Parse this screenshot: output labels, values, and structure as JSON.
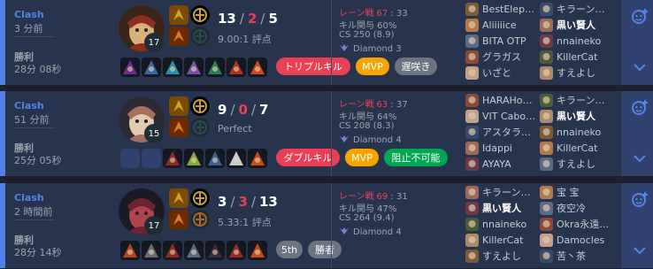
{
  "matches": [
    {
      "type": "Clash",
      "time": "3 分前",
      "result": "勝利",
      "duration": "28分 08秒",
      "level": "17",
      "kills": "13",
      "deaths": "2",
      "assists": "5",
      "ratio": "9.00:1 評点",
      "lane_label": "レーン戦",
      "lane_score": "67",
      "lane_opp": "33",
      "kp": "キル関与 60%",
      "cs": "CS 250 (8.9)",
      "rank": "Diamond 3",
      "badges": [
        "トリプルキル",
        "MVP",
        "遅咲き"
      ],
      "team_a": [
        "BestElep…",
        "Aliiiiice",
        "BITA OTP",
        "グラガス",
        "いざと"
      ],
      "team_b": [
        "キラーン…",
        "黒い賢人",
        "nnaineko",
        "KillerCat",
        "すえよし"
      ],
      "me_team": "b",
      "me_index": 1
    },
    {
      "type": "Clash",
      "time": "51 分前",
      "result": "勝利",
      "duration": "25分 05秒",
      "level": "15",
      "kills": "9",
      "deaths": "0",
      "assists": "7",
      "ratio": "Perfect",
      "lane_label": "レーン戦",
      "lane_score": "63",
      "lane_opp": "37",
      "kp": "キル関与 64%",
      "cs": "CS 208 (8.3)",
      "rank": "Diamond 4",
      "badges": [
        "ダブルキル",
        "MVP",
        "阻止不可能"
      ],
      "team_a": [
        "HARAHo…",
        "VIT Cabo…",
        "アスタラ…",
        "Idappi",
        "AYAYA"
      ],
      "team_b": [
        "キラーン…",
        "黒い賢人",
        "nnaineko",
        "KillerCat",
        "すえよし"
      ],
      "me_team": "b",
      "me_index": 1
    },
    {
      "type": "Clash",
      "time": "2 時間前",
      "result": "勝利",
      "duration": "28分 14秒",
      "level": "17",
      "kills": "3",
      "deaths": "3",
      "assists": "13",
      "ratio": "5.33:1 評点",
      "lane_label": "レーン戦",
      "lane_score": "69",
      "lane_opp": "31",
      "kp": "キル関与 47%",
      "cs": "CS 264 (9.4)",
      "rank": "Diamond 4",
      "badges": [
        "5th",
        "勝者"
      ],
      "team_a": [
        "キラーン…",
        "黒い賢人",
        "nnaineko",
        "KillerCat",
        "すえよし"
      ],
      "team_b": [
        "宝 宝",
        "夜空冷",
        "Okra永遠…",
        "Damocles",
        "苦丶茶"
      ],
      "me_team": "a",
      "me_index": 1
    }
  ],
  "colors": {
    "win_accent": "#5383e8",
    "kill_red": "#e84057",
    "mvp": "#f4a500",
    "grey_badge": "#6c7383",
    "green_badge": "#00a652"
  },
  "icons": {
    "add": "add-friend-icon",
    "expand": "chevron-down-icon",
    "rank": "diamond-rank-icon"
  }
}
